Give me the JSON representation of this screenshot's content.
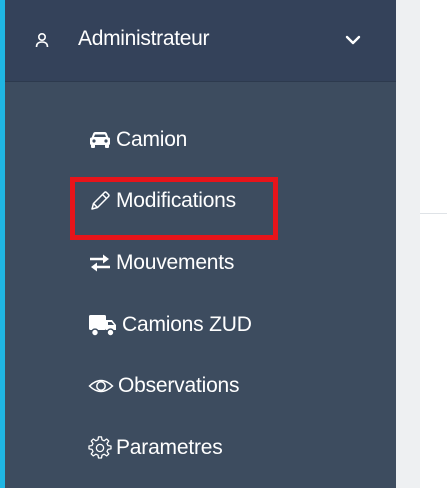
{
  "sidebar": {
    "header": {
      "label": "Administrateur",
      "icon": "user-icon",
      "toggle_icon": "chevron-down-icon"
    },
    "items": [
      {
        "label": "Camion",
        "icon": "car-icon"
      },
      {
        "label": "Modifications",
        "icon": "pencil-icon",
        "highlighted": true
      },
      {
        "label": "Mouvements",
        "icon": "exchange-arrows-icon"
      },
      {
        "label": "Camions ZUD",
        "icon": "truck-icon"
      },
      {
        "label": "Observations",
        "icon": "eye-icon"
      },
      {
        "label": "Parametres",
        "icon": "gear-icon"
      }
    ]
  },
  "colors": {
    "sidebar_bg": "#3d4c5f",
    "header_bg": "#34425a",
    "accent": "#1fb6e4",
    "highlight": "#e8141a",
    "text": "#ffffff"
  }
}
